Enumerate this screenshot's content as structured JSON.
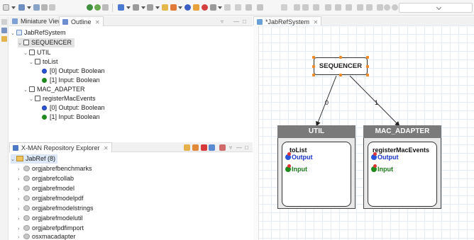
{
  "toolbar": {
    "icons": [
      "new-icon",
      "save-icon",
      "save-all-icon",
      "print-icon",
      "run-icon",
      "debug-icon",
      "search-icon",
      "back-icon",
      "forward-icon",
      "zoom-in-icon",
      "zoom-out-icon"
    ],
    "dropdown_value": ""
  },
  "outline_panel": {
    "tabs": [
      {
        "label": "Miniature View",
        "active": false
      },
      {
        "label": "Outline",
        "active": true
      }
    ],
    "tree": {
      "root": "JabRefSystem",
      "sequencer": "SEQUENCER",
      "util": {
        "label": "UTIL",
        "component": "toList",
        "ports": [
          "[0] Output: Boolean",
          "[1] Input: Boolean"
        ]
      },
      "mac_adapter": {
        "label": "MAC_ADAPTER",
        "component": "registerMacEvents",
        "ports": [
          "[0] Output: Boolean",
          "[1] Input: Boolean"
        ]
      }
    }
  },
  "explorer_panel": {
    "title": "X-MAN Repository Explorer",
    "project": "JabRef (8)",
    "packages": [
      "orgjabrefbenchmarks",
      "orgjabrefcollab",
      "orgjabrefmodel",
      "orgjabrefmodelpdf",
      "orgjabrefmodelstrings",
      "orgjabrefmodelutil",
      "orgjabrefpdfimport",
      "osxmacadapter"
    ]
  },
  "editor": {
    "tab_label": "*JabRefSystem",
    "diagram": {
      "sequencer_label": "SEQUENCER",
      "edge_labels": [
        "0",
        "1"
      ],
      "components": [
        {
          "head": "UTIL",
          "name": "toList",
          "output": "Output",
          "input": "Input"
        },
        {
          "head": "MAC_ADAPTER",
          "name": "registerMacEvents",
          "output": "Output",
          "input": "Input"
        }
      ]
    }
  },
  "colors": {
    "component_header": "#7a7a7a",
    "output_port": "#1c33c8",
    "input_port": "#1a7a1a",
    "selection_handle": "#f08a24"
  }
}
